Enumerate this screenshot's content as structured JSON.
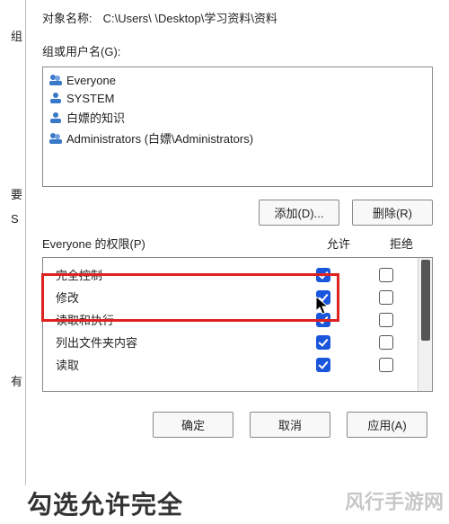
{
  "left_sidebar": {
    "l1": "组",
    "l2": "要",
    "l3": "S",
    "l4": "有"
  },
  "object_name": {
    "label": "对象名称:",
    "value": "C:\\Users\\          \\Desktop\\学习资料\\资料"
  },
  "groups_label": "组或用户名(G):",
  "groups": [
    {
      "icon": "two-person-icon",
      "label": "Everyone"
    },
    {
      "icon": "person-icon",
      "label": "SYSTEM"
    },
    {
      "icon": "person-icon",
      "label": "白嫖的知识"
    },
    {
      "icon": "two-person-icon",
      "label": "Administrators (白嫖\\Administrators)"
    }
  ],
  "buttons": {
    "add": "添加(D)...",
    "remove": "删除(R)",
    "ok": "确定",
    "cancel": "取消",
    "apply": "应用(A)"
  },
  "perm_header": {
    "title": "Everyone 的权限(P)",
    "allow": "允许",
    "deny": "拒绝"
  },
  "permissions": [
    {
      "name": "完全控制",
      "allow": true,
      "deny": false
    },
    {
      "name": "修改",
      "allow": true,
      "deny": false
    },
    {
      "name": "读取和执行",
      "allow": true,
      "deny": false
    },
    {
      "name": "列出文件夹内容",
      "allow": true,
      "deny": false
    },
    {
      "name": "读取",
      "allow": true,
      "deny": false
    }
  ],
  "caption": "勾选允许完全",
  "watermark": "风行手游网",
  "colors": {
    "highlight": "#d22",
    "checkbox_checked": "#1a56db"
  }
}
